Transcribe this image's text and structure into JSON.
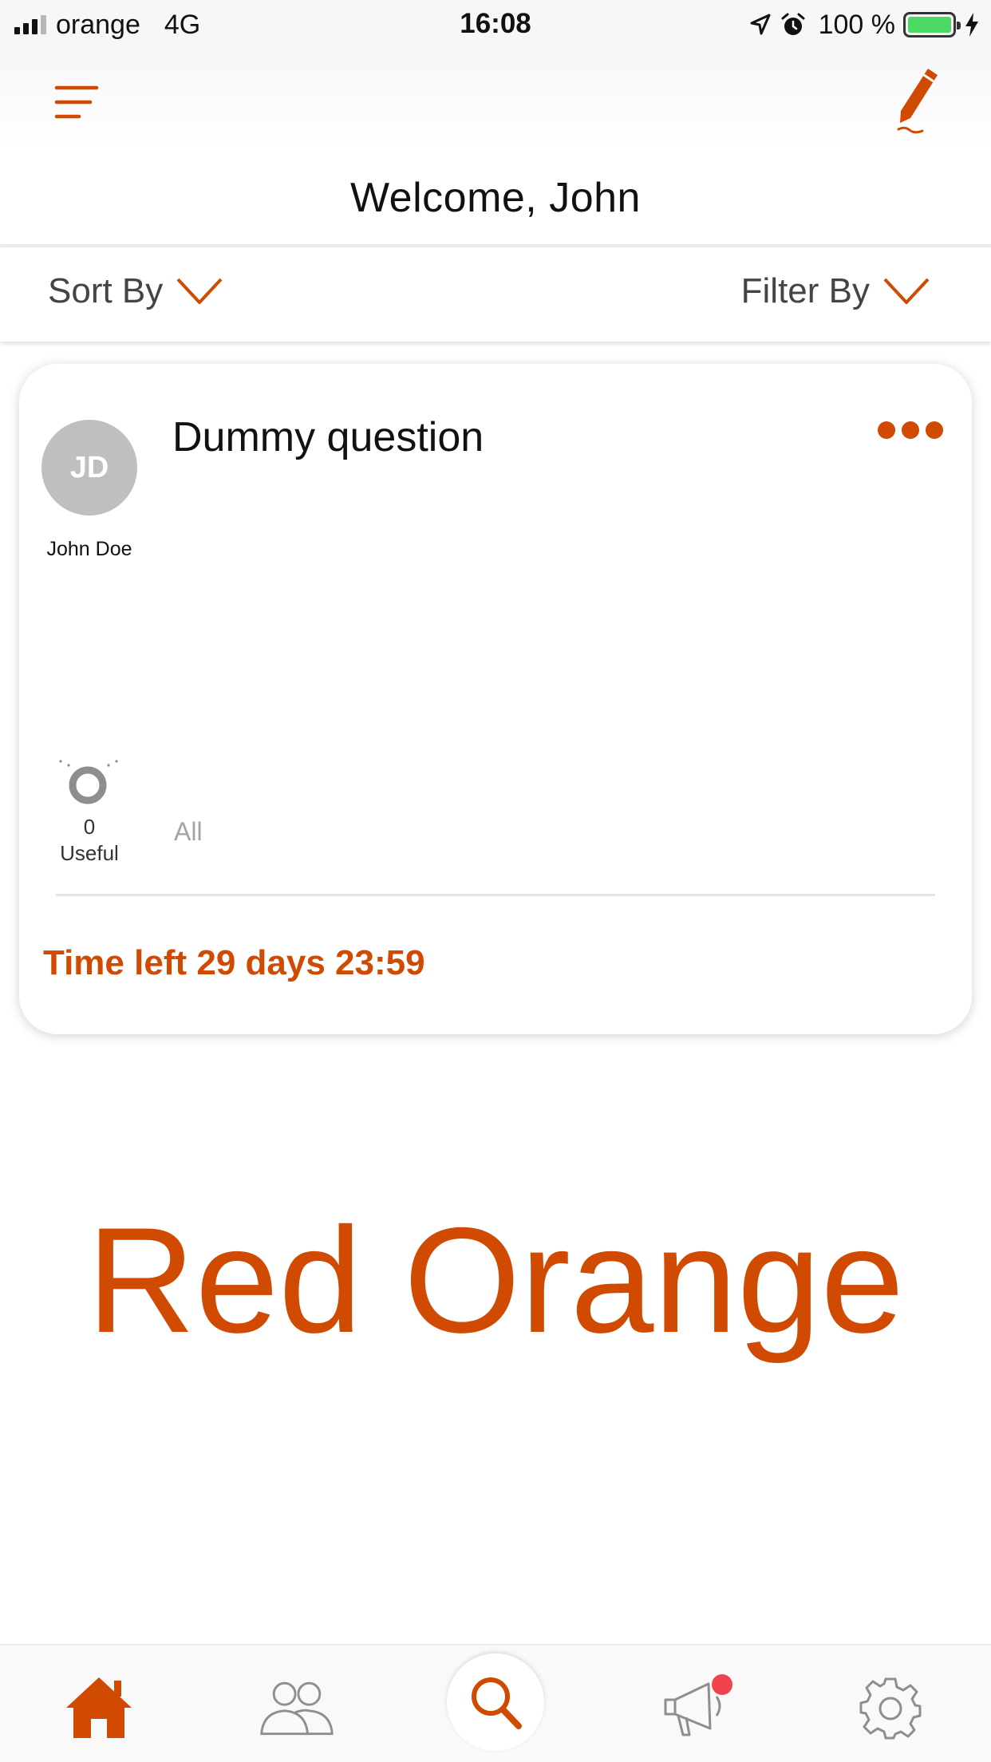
{
  "status_bar": {
    "carrier": "orange",
    "network": "4G",
    "time": "16:08",
    "battery": "100 %"
  },
  "header": {
    "welcome": "Welcome, John"
  },
  "sort_bar": {
    "sort_label": "Sort By",
    "filter_label": "Filter By"
  },
  "question_card": {
    "avatar_initials": "JD",
    "author": "John Doe",
    "title": "Dummy question",
    "useful_count": "0",
    "useful_label": "Useful",
    "all_label": "All",
    "time_left": "Time left 29 days 23:59"
  },
  "watermark": "Red Orange",
  "tab_bar": {
    "items": [
      "home-icon",
      "users-icon",
      "search-icon",
      "megaphone-icon",
      "gear-icon"
    ],
    "active": "home-icon"
  },
  "colors": {
    "accent": "#d04a02",
    "notification": "#f0434c",
    "avatar_bg": "#bfbfbf",
    "icon_gray": "#8e8e8e",
    "battery_green": "#4cd964"
  }
}
